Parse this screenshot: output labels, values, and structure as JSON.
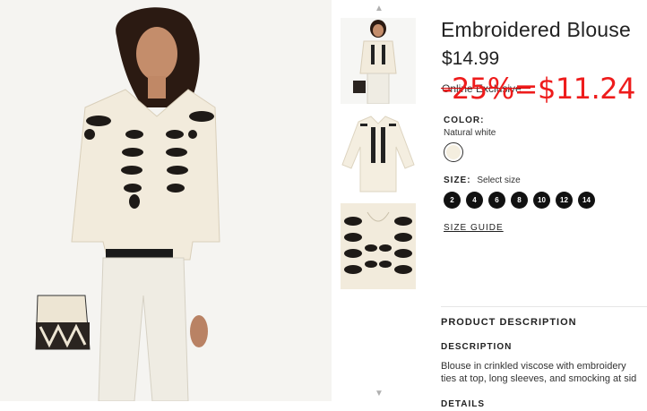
{
  "product": {
    "title": "Embroidered Blouse",
    "price": "$14.99",
    "online_exclusive": "Online Exclusive",
    "sale_overlay": "-25%=$11.24",
    "color_label": "COLOR:",
    "color_value": "Natural white",
    "size_label": "SIZE:",
    "size_select": "Select size",
    "sizes": [
      "2",
      "4",
      "6",
      "8",
      "10",
      "12",
      "14"
    ],
    "size_guide": "SIZE GUIDE",
    "product_description_heading": "PRODUCT DESCRIPTION",
    "description_heading": "DESCRIPTION",
    "description_lines": [
      "Blouse in crinkled viscose with embroidery",
      "ties at top, long sleeves, and smocking at sid"
    ],
    "details_heading": "DETAILS"
  },
  "colors": {
    "sale_red": "#ee1c1c",
    "swatch": "#f4eedf",
    "size_bg": "#111111"
  },
  "icons": {
    "thumb_up": "chevron-up-icon",
    "thumb_down": "chevron-down-icon"
  }
}
